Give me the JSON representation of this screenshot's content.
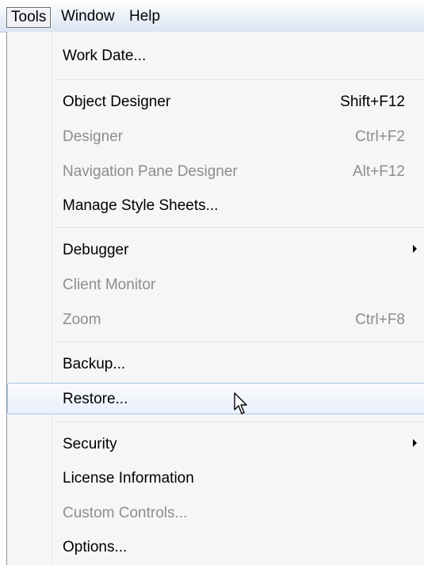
{
  "menubar": {
    "items": [
      {
        "label": "Tools",
        "active": true
      },
      {
        "label": "Window",
        "active": false
      },
      {
        "label": "Help",
        "active": false
      }
    ]
  },
  "menu": {
    "items": [
      {
        "label": "Work Date...",
        "shortcut": "",
        "enabled": true
      },
      {
        "label": "Object Designer",
        "shortcut": "Shift+F12",
        "enabled": true
      },
      {
        "label": "Designer",
        "shortcut": "Ctrl+F2",
        "enabled": false
      },
      {
        "label": "Navigation Pane Designer",
        "shortcut": "Alt+F12",
        "enabled": false
      },
      {
        "label": "Manage Style Sheets...",
        "shortcut": "",
        "enabled": true
      },
      {
        "label": "Debugger",
        "shortcut": "",
        "enabled": true,
        "submenu": true
      },
      {
        "label": "Client Monitor",
        "shortcut": "",
        "enabled": false
      },
      {
        "label": "Zoom",
        "shortcut": "Ctrl+F8",
        "enabled": false
      },
      {
        "label": "Backup...",
        "shortcut": "",
        "enabled": true
      },
      {
        "label": "Restore...",
        "shortcut": "",
        "enabled": true,
        "highlighted": true
      },
      {
        "label": "Security",
        "shortcut": "",
        "enabled": true,
        "submenu": true
      },
      {
        "label": "License Information",
        "shortcut": "",
        "enabled": true
      },
      {
        "label": "Custom Controls...",
        "shortcut": "",
        "enabled": false
      },
      {
        "label": "Options...",
        "shortcut": "",
        "enabled": true
      }
    ]
  },
  "colors": {
    "disabled_text": "#8d8d8d",
    "highlight_border": "#a9c3e4",
    "menu_background": "#f5f6f7"
  }
}
